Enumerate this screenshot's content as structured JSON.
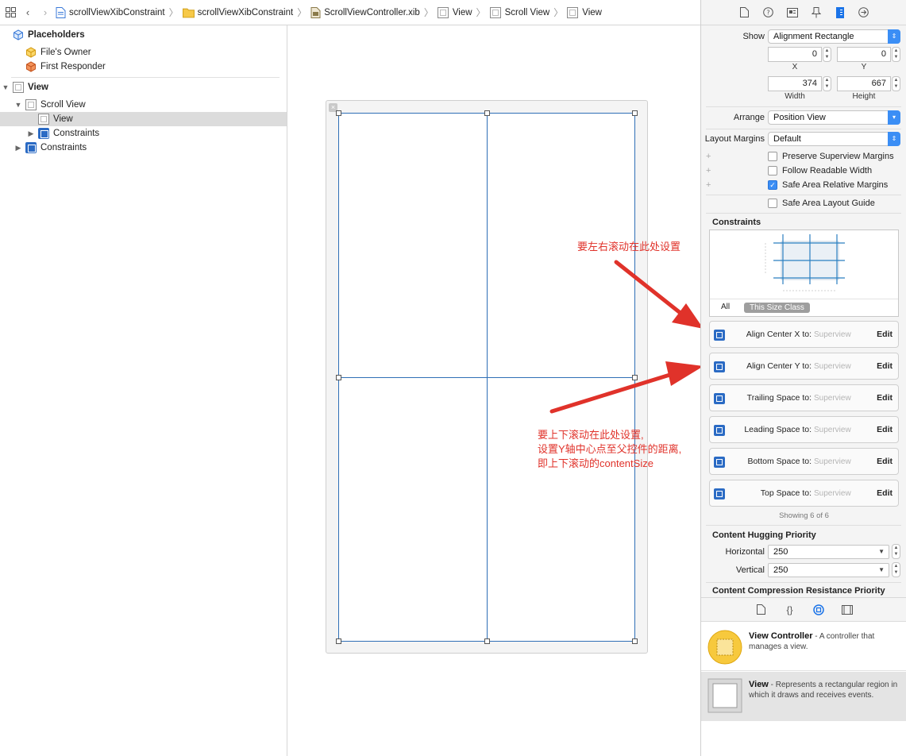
{
  "jumpbar": {
    "crumbs": [
      "scrollViewXibConstraint",
      "scrollViewXibConstraint",
      "ScrollViewController.xib",
      "View",
      "Scroll View",
      "View"
    ]
  },
  "outline": {
    "placeholders": "Placeholders",
    "files_owner": "File's Owner",
    "first_responder": "First Responder",
    "view": "View",
    "scroll_view": "Scroll View",
    "inner_view": "View",
    "constraints_inner": "Constraints",
    "constraints_outer": "Constraints"
  },
  "annotations": {
    "horizontal_note": "要左右滚动在此处设置",
    "vertical_note_1": "要上下滚动在此处设置,",
    "vertical_note_2": "设置Y轴中心点至父控件的距离,",
    "vertical_note_3": "即上下滚动的contentSize",
    "color": "#e0322a"
  },
  "inspector": {
    "show_label": "Show",
    "show_value": "Alignment Rectangle",
    "x_value": "0",
    "y_value": "0",
    "x_label": "X",
    "y_label": "Y",
    "width_value": "374",
    "height_value": "667",
    "width_label": "Width",
    "height_label": "Height",
    "arrange_label": "Arrange",
    "arrange_value": "Position View",
    "margins_label": "Layout Margins",
    "margins_value": "Default",
    "preserve": "Preserve Superview Margins",
    "readable": "Follow Readable Width",
    "safe_margins": "Safe Area Relative Margins",
    "safe_guide": "Safe Area Layout Guide",
    "constraints_title": "Constraints",
    "all_label": "All",
    "size_class_label": "This Size Class",
    "constraints": [
      {
        "label": "Align Center X to:",
        "target": "Superview",
        "edit": "Edit"
      },
      {
        "label": "Align Center Y to:",
        "target": "Superview",
        "edit": "Edit"
      },
      {
        "label": "Trailing Space to:",
        "target": "Superview",
        "edit": "Edit"
      },
      {
        "label": "Leading Space to:",
        "target": "Superview",
        "edit": "Edit"
      },
      {
        "label": "Bottom Space to:",
        "target": "Superview",
        "edit": "Edit"
      },
      {
        "label": "Top Space to:",
        "target": "Superview",
        "edit": "Edit"
      }
    ],
    "showing": "Showing 6 of 6",
    "hugging_title": "Content Hugging Priority",
    "horizontal_label": "Horizontal",
    "horizontal_value": "250",
    "vertical_label": "Vertical",
    "vertical_value": "250",
    "compression_title": "Content Compression Resistance Priority"
  },
  "library": {
    "vc_title": "View Controller",
    "vc_desc": " - A controller that manages a view.",
    "view_title": "View",
    "view_desc": " - Represents a rectangular region in which it draws and receives events."
  }
}
